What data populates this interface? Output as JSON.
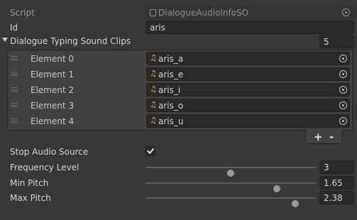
{
  "script": {
    "label": "Script",
    "value": "DialogueAudioInfoSO"
  },
  "id": {
    "label": "Id",
    "value": "aris"
  },
  "list": {
    "label": "Dialogue Typing Sound Clips",
    "size": "5",
    "elements": [
      {
        "label": "Element 0",
        "value": "aris_a"
      },
      {
        "label": "Element 1",
        "value": "aris_e"
      },
      {
        "label": "Element 2",
        "value": "aris_i"
      },
      {
        "label": "Element 3",
        "value": "aris_o"
      },
      {
        "label": "Element 4",
        "value": "aris_u"
      }
    ],
    "add": "+",
    "remove": "-"
  },
  "stop_audio": {
    "label": "Stop Audio Source",
    "checked": true
  },
  "frequency": {
    "label": "Frequency Level",
    "value": "3",
    "slider_fraction": 0.5
  },
  "min_pitch": {
    "label": "Min Pitch",
    "value": "1.65",
    "slider_fraction": 0.77
  },
  "max_pitch": {
    "label": "Max Pitch",
    "value": "2.38",
    "slider_fraction": 0.88
  },
  "icons": {
    "audio": "music-note-icon",
    "picker": "object-picker-icon"
  }
}
